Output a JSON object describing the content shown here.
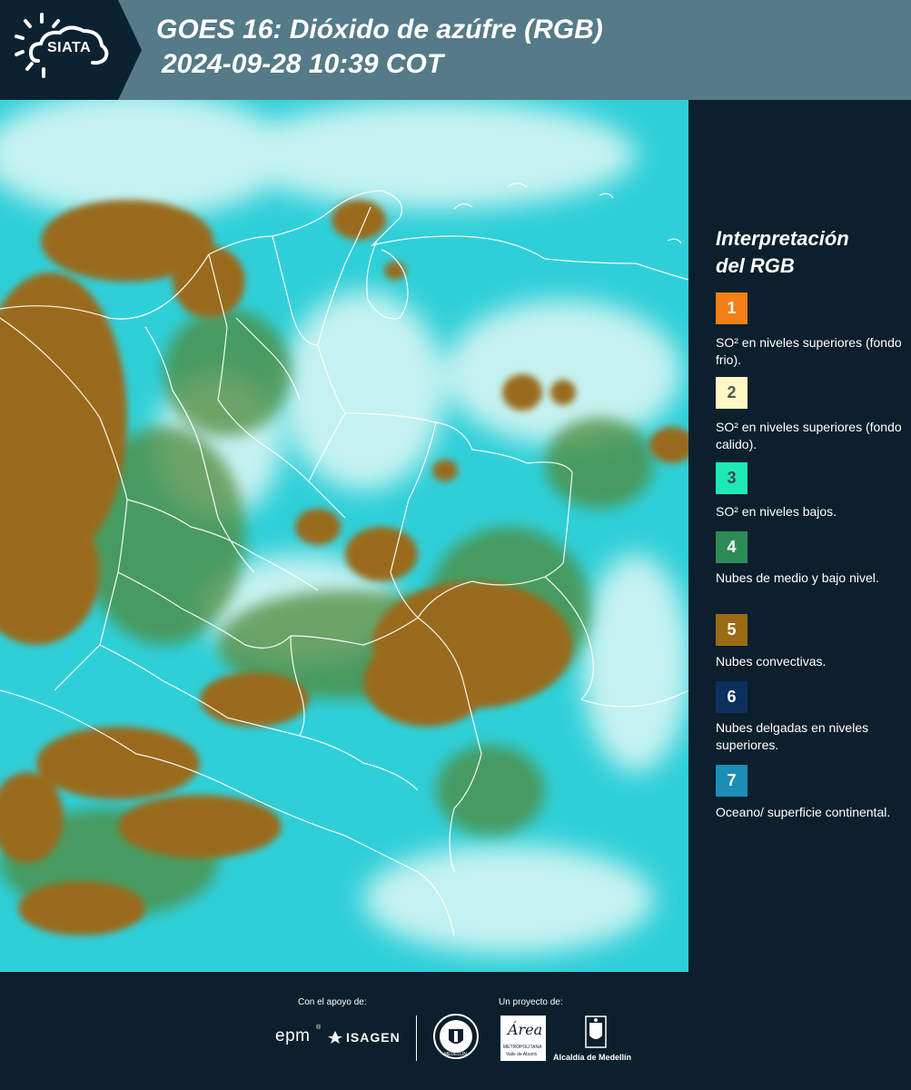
{
  "header": {
    "logo_text": "SIATA",
    "title_line1": "GOES 16: Dióxido de azúfre (RGB)",
    "title_line2": "2024-09-28 10:39 COT"
  },
  "legend": {
    "title_line1": "Interpretación",
    "title_line2": "del RGB",
    "items": [
      {
        "number": "1",
        "color": "#f57f17",
        "label": "SO² en niveles superiores (fondo frio)."
      },
      {
        "number": "2",
        "color": "#fff8c4",
        "label": "SO² en niveles superiores (fondo calido)."
      },
      {
        "number": "3",
        "color": "#1de9b6",
        "label": "SO² en niveles bajos."
      },
      {
        "number": "4",
        "color": "#2e8b57",
        "label": "Nubes de medio y bajo nivel."
      },
      {
        "number": "5",
        "color": "#9a6a14",
        "label": "Nubes convectivas."
      },
      {
        "number": "6",
        "color": "#0d2f5e",
        "label": "Nubes delgadas en niveles superiores."
      },
      {
        "number": "7",
        "color": "#1b8fb5",
        "label": "Oceano/ superficie continental."
      }
    ]
  },
  "footer": {
    "support_label": "Con el apoyo de:",
    "project_label": "Un proyecto de:",
    "epm": "epm",
    "isagen": "ISAGEN",
    "area_name": "Área",
    "area_sub1": "METROPOLITANA",
    "area_sub2": "Valle de Aburrá",
    "alcaldia": "Alcaldía de Medellín",
    "seal_text": "MEDELLÍN"
  },
  "colors": {
    "cyan": "#2fcfd8",
    "cloud_white": "#d9f7f7",
    "convective": "#9a6a1e",
    "mid_cloud": "#4f8a3a"
  }
}
